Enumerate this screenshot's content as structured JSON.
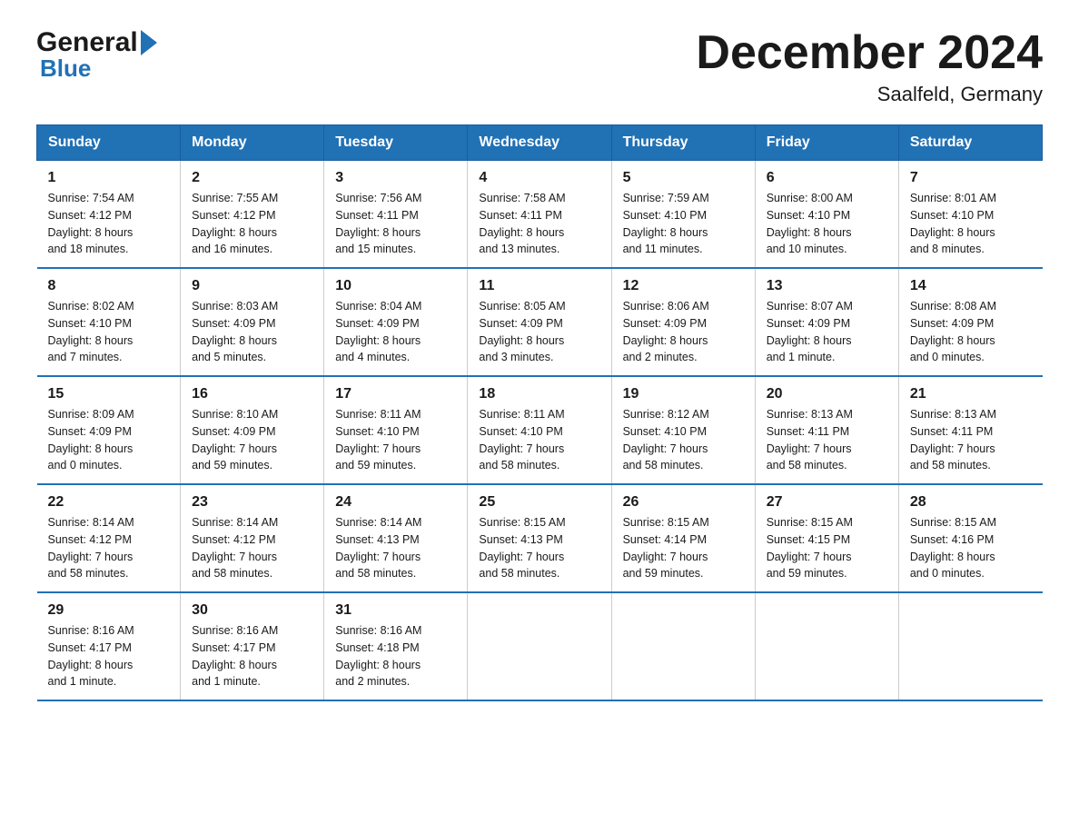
{
  "header": {
    "title": "December 2024",
    "subtitle": "Saalfeld, Germany",
    "logo_general": "General",
    "logo_blue": "Blue"
  },
  "weekdays": [
    "Sunday",
    "Monday",
    "Tuesday",
    "Wednesday",
    "Thursday",
    "Friday",
    "Saturday"
  ],
  "weeks": [
    [
      {
        "day": "1",
        "sunrise": "7:54 AM",
        "sunset": "4:12 PM",
        "daylight": "8 hours and 18 minutes."
      },
      {
        "day": "2",
        "sunrise": "7:55 AM",
        "sunset": "4:12 PM",
        "daylight": "8 hours and 16 minutes."
      },
      {
        "day": "3",
        "sunrise": "7:56 AM",
        "sunset": "4:11 PM",
        "daylight": "8 hours and 15 minutes."
      },
      {
        "day": "4",
        "sunrise": "7:58 AM",
        "sunset": "4:11 PM",
        "daylight": "8 hours and 13 minutes."
      },
      {
        "day": "5",
        "sunrise": "7:59 AM",
        "sunset": "4:10 PM",
        "daylight": "8 hours and 11 minutes."
      },
      {
        "day": "6",
        "sunrise": "8:00 AM",
        "sunset": "4:10 PM",
        "daylight": "8 hours and 10 minutes."
      },
      {
        "day": "7",
        "sunrise": "8:01 AM",
        "sunset": "4:10 PM",
        "daylight": "8 hours and 8 minutes."
      }
    ],
    [
      {
        "day": "8",
        "sunrise": "8:02 AM",
        "sunset": "4:10 PM",
        "daylight": "8 hours and 7 minutes."
      },
      {
        "day": "9",
        "sunrise": "8:03 AM",
        "sunset": "4:09 PM",
        "daylight": "8 hours and 5 minutes."
      },
      {
        "day": "10",
        "sunrise": "8:04 AM",
        "sunset": "4:09 PM",
        "daylight": "8 hours and 4 minutes."
      },
      {
        "day": "11",
        "sunrise": "8:05 AM",
        "sunset": "4:09 PM",
        "daylight": "8 hours and 3 minutes."
      },
      {
        "day": "12",
        "sunrise": "8:06 AM",
        "sunset": "4:09 PM",
        "daylight": "8 hours and 2 minutes."
      },
      {
        "day": "13",
        "sunrise": "8:07 AM",
        "sunset": "4:09 PM",
        "daylight": "8 hours and 1 minute."
      },
      {
        "day": "14",
        "sunrise": "8:08 AM",
        "sunset": "4:09 PM",
        "daylight": "8 hours and 0 minutes."
      }
    ],
    [
      {
        "day": "15",
        "sunrise": "8:09 AM",
        "sunset": "4:09 PM",
        "daylight": "8 hours and 0 minutes."
      },
      {
        "day": "16",
        "sunrise": "8:10 AM",
        "sunset": "4:09 PM",
        "daylight": "7 hours and 59 minutes."
      },
      {
        "day": "17",
        "sunrise": "8:11 AM",
        "sunset": "4:10 PM",
        "daylight": "7 hours and 59 minutes."
      },
      {
        "day": "18",
        "sunrise": "8:11 AM",
        "sunset": "4:10 PM",
        "daylight": "7 hours and 58 minutes."
      },
      {
        "day": "19",
        "sunrise": "8:12 AM",
        "sunset": "4:10 PM",
        "daylight": "7 hours and 58 minutes."
      },
      {
        "day": "20",
        "sunrise": "8:13 AM",
        "sunset": "4:11 PM",
        "daylight": "7 hours and 58 minutes."
      },
      {
        "day": "21",
        "sunrise": "8:13 AM",
        "sunset": "4:11 PM",
        "daylight": "7 hours and 58 minutes."
      }
    ],
    [
      {
        "day": "22",
        "sunrise": "8:14 AM",
        "sunset": "4:12 PM",
        "daylight": "7 hours and 58 minutes."
      },
      {
        "day": "23",
        "sunrise": "8:14 AM",
        "sunset": "4:12 PM",
        "daylight": "7 hours and 58 minutes."
      },
      {
        "day": "24",
        "sunrise": "8:14 AM",
        "sunset": "4:13 PM",
        "daylight": "7 hours and 58 minutes."
      },
      {
        "day": "25",
        "sunrise": "8:15 AM",
        "sunset": "4:13 PM",
        "daylight": "7 hours and 58 minutes."
      },
      {
        "day": "26",
        "sunrise": "8:15 AM",
        "sunset": "4:14 PM",
        "daylight": "7 hours and 59 minutes."
      },
      {
        "day": "27",
        "sunrise": "8:15 AM",
        "sunset": "4:15 PM",
        "daylight": "7 hours and 59 minutes."
      },
      {
        "day": "28",
        "sunrise": "8:15 AM",
        "sunset": "4:16 PM",
        "daylight": "8 hours and 0 minutes."
      }
    ],
    [
      {
        "day": "29",
        "sunrise": "8:16 AM",
        "sunset": "4:17 PM",
        "daylight": "8 hours and 1 minute."
      },
      {
        "day": "30",
        "sunrise": "8:16 AM",
        "sunset": "4:17 PM",
        "daylight": "8 hours and 1 minute."
      },
      {
        "day": "31",
        "sunrise": "8:16 AM",
        "sunset": "4:18 PM",
        "daylight": "8 hours and 2 minutes."
      },
      null,
      null,
      null,
      null
    ]
  ],
  "labels": {
    "sunrise": "Sunrise:",
    "sunset": "Sunset:",
    "daylight": "Daylight:"
  }
}
